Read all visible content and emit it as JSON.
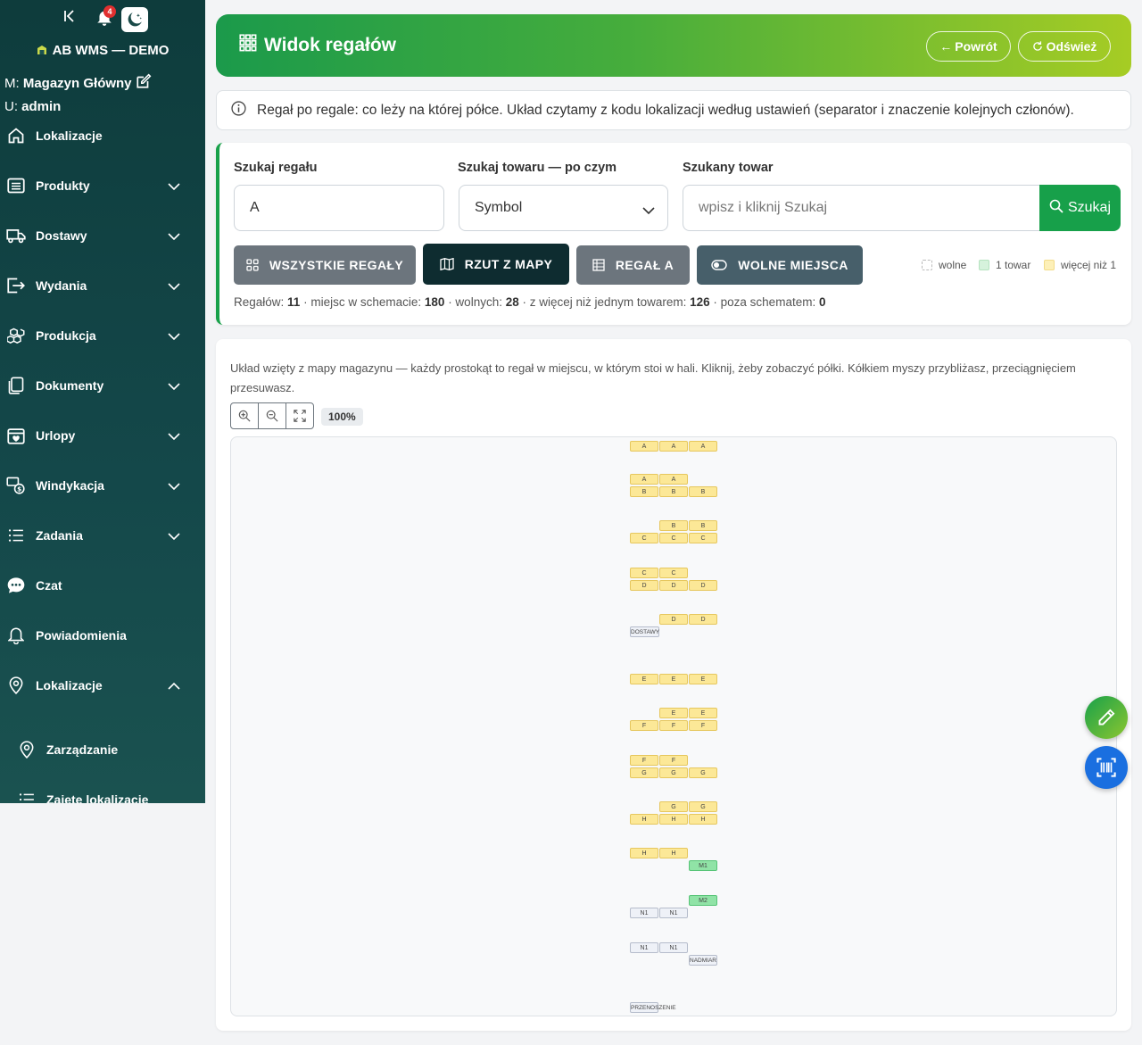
{
  "app": {
    "brand": "AB WMS — DEMO",
    "notification_count": "4",
    "warehouse_prefix": "M:",
    "warehouse": "Magazyn Główny",
    "user_prefix": "U:",
    "user": "admin"
  },
  "sidebar": {
    "items": [
      {
        "label": "Lokalizacje",
        "icon": "home-icon"
      },
      {
        "label": "Produkty",
        "icon": "list-box-icon"
      },
      {
        "label": "Dostawy",
        "icon": "truck-icon"
      },
      {
        "label": "Wydania",
        "icon": "exit-icon"
      },
      {
        "label": "Produkcja",
        "icon": "boxes-icon"
      },
      {
        "label": "Dokumenty",
        "icon": "documents-icon"
      },
      {
        "label": "Urlopy",
        "icon": "calendar-heart-icon"
      },
      {
        "label": "Windykacja",
        "icon": "cash-stack-icon"
      },
      {
        "label": "Zadania",
        "icon": "list-task-icon"
      },
      {
        "label": "Czat",
        "icon": "chat-icon"
      },
      {
        "label": "Powiadomienia",
        "icon": "bell-icon"
      },
      {
        "label": "Lokalizacje",
        "icon": "geo-alt-icon"
      }
    ],
    "subitems": [
      {
        "label": "Zarządzanie",
        "icon": "geo-alt-icon"
      },
      {
        "label": "Zajęte lokalizacje",
        "icon": "list-icon"
      }
    ]
  },
  "header": {
    "title": "Widok regałów",
    "back_label": "Powrót",
    "refresh_label": "Odśwież",
    "colors": {
      "gradient_start": "#1b9a4b",
      "gradient_end": "#a6cc24"
    }
  },
  "info": {
    "text": "Regał po regale: co leży na której półce. Układ czytamy z kodu lokalizacji według ustawień (separator i znaczenie kolejnych członów)."
  },
  "search": {
    "rack_label": "Szukaj regału",
    "rack_value": "A",
    "by_label": "Szukaj towaru — po czym",
    "by_value": "Symbol",
    "item_label": "Szukany towar",
    "item_placeholder": "wpisz i kliknij Szukaj",
    "button": "Szukaj",
    "filters": {
      "all": "WSZYSTKIE REGAŁY",
      "map": "RZUT Z MAPY",
      "rack": "REGAŁ A",
      "free": "WOLNE MIEJSCA"
    },
    "legend": {
      "free": "wolne",
      "one": "1 towar",
      "multi": "więcej niż 1"
    },
    "stats": {
      "racks_label": "Regałów:",
      "racks": "11",
      "places_label": "· miejsc w schemacie:",
      "places": "180",
      "free_label": "· wolnych:",
      "free": "28",
      "multi_label": "· z więcej niż jednym towarem:",
      "multi": "126",
      "outside_label": "· poza schematem:",
      "outside": "0"
    }
  },
  "map": {
    "description": "Układ wzięty z mapy magazynu — każdy prostokąt to regał w miejscu, w którym stoi w hali. Kliknij, żeby zobaczyć półki. Kółkiem myszy przybliżasz, przeciągnięciem przesuwasz.",
    "zoom": "100%",
    "status_colors": {
      "multi": "#fce897",
      "one": "#90e3a6",
      "free": "#eef1f7"
    },
    "rows": [
      [
        {
          "l": "A",
          "s": "multi"
        },
        {
          "l": "A",
          "s": "multi"
        },
        {
          "l": "A",
          "s": "multi"
        }
      ],
      [
        {
          "l": "A",
          "s": "multi"
        },
        {
          "l": "A",
          "s": "multi"
        },
        null
      ],
      [
        {
          "l": "B",
          "s": "multi"
        },
        {
          "l": "B",
          "s": "multi"
        },
        {
          "l": "B",
          "s": "multi"
        }
      ],
      [
        null,
        {
          "l": "B",
          "s": "multi"
        },
        {
          "l": "B",
          "s": "multi"
        }
      ],
      [
        {
          "l": "C",
          "s": "multi"
        },
        {
          "l": "C",
          "s": "multi"
        },
        {
          "l": "C",
          "s": "multi"
        }
      ],
      [
        {
          "l": "C",
          "s": "multi"
        },
        {
          "l": "C",
          "s": "multi"
        },
        null
      ],
      [
        {
          "l": "D",
          "s": "multi"
        },
        {
          "l": "D",
          "s": "multi"
        },
        {
          "l": "D",
          "s": "multi"
        }
      ],
      [
        null,
        {
          "l": "D",
          "s": "multi"
        },
        {
          "l": "D",
          "s": "multi"
        }
      ],
      [
        {
          "l": "E",
          "s": "multi"
        },
        {
          "l": "E",
          "s": "multi"
        },
        {
          "l": "E",
          "s": "multi"
        }
      ],
      [
        null,
        {
          "l": "E",
          "s": "multi"
        },
        {
          "l": "E",
          "s": "multi"
        }
      ],
      [
        {
          "l": "F",
          "s": "multi"
        },
        {
          "l": "F",
          "s": "multi"
        },
        {
          "l": "F",
          "s": "multi"
        }
      ],
      [
        {
          "l": "F",
          "s": "multi"
        },
        {
          "l": "F",
          "s": "multi"
        },
        null
      ],
      [
        {
          "l": "G",
          "s": "multi"
        },
        {
          "l": "G",
          "s": "multi"
        },
        {
          "l": "G",
          "s": "multi"
        }
      ],
      [
        null,
        {
          "l": "G",
          "s": "multi"
        },
        {
          "l": "G",
          "s": "multi"
        }
      ],
      [
        {
          "l": "H",
          "s": "multi"
        },
        {
          "l": "H",
          "s": "multi"
        },
        {
          "l": "H",
          "s": "multi"
        }
      ],
      [
        {
          "l": "H",
          "s": "multi"
        },
        {
          "l": "H",
          "s": "multi"
        },
        null
      ],
      [
        null,
        null,
        {
          "l": "M1",
          "s": "one"
        }
      ],
      [
        null,
        null,
        {
          "l": "M2",
          "s": "one"
        }
      ],
      [
        {
          "l": "N1",
          "s": "free"
        },
        {
          "l": "N1",
          "s": "free"
        },
        null
      ],
      [
        {
          "l": "N1",
          "s": "free"
        },
        {
          "l": "N1",
          "s": "free"
        },
        null
      ]
    ],
    "zones": [
      "DOSTAWY",
      "NADMIAR",
      "PRZENOSZENIE"
    ]
  }
}
